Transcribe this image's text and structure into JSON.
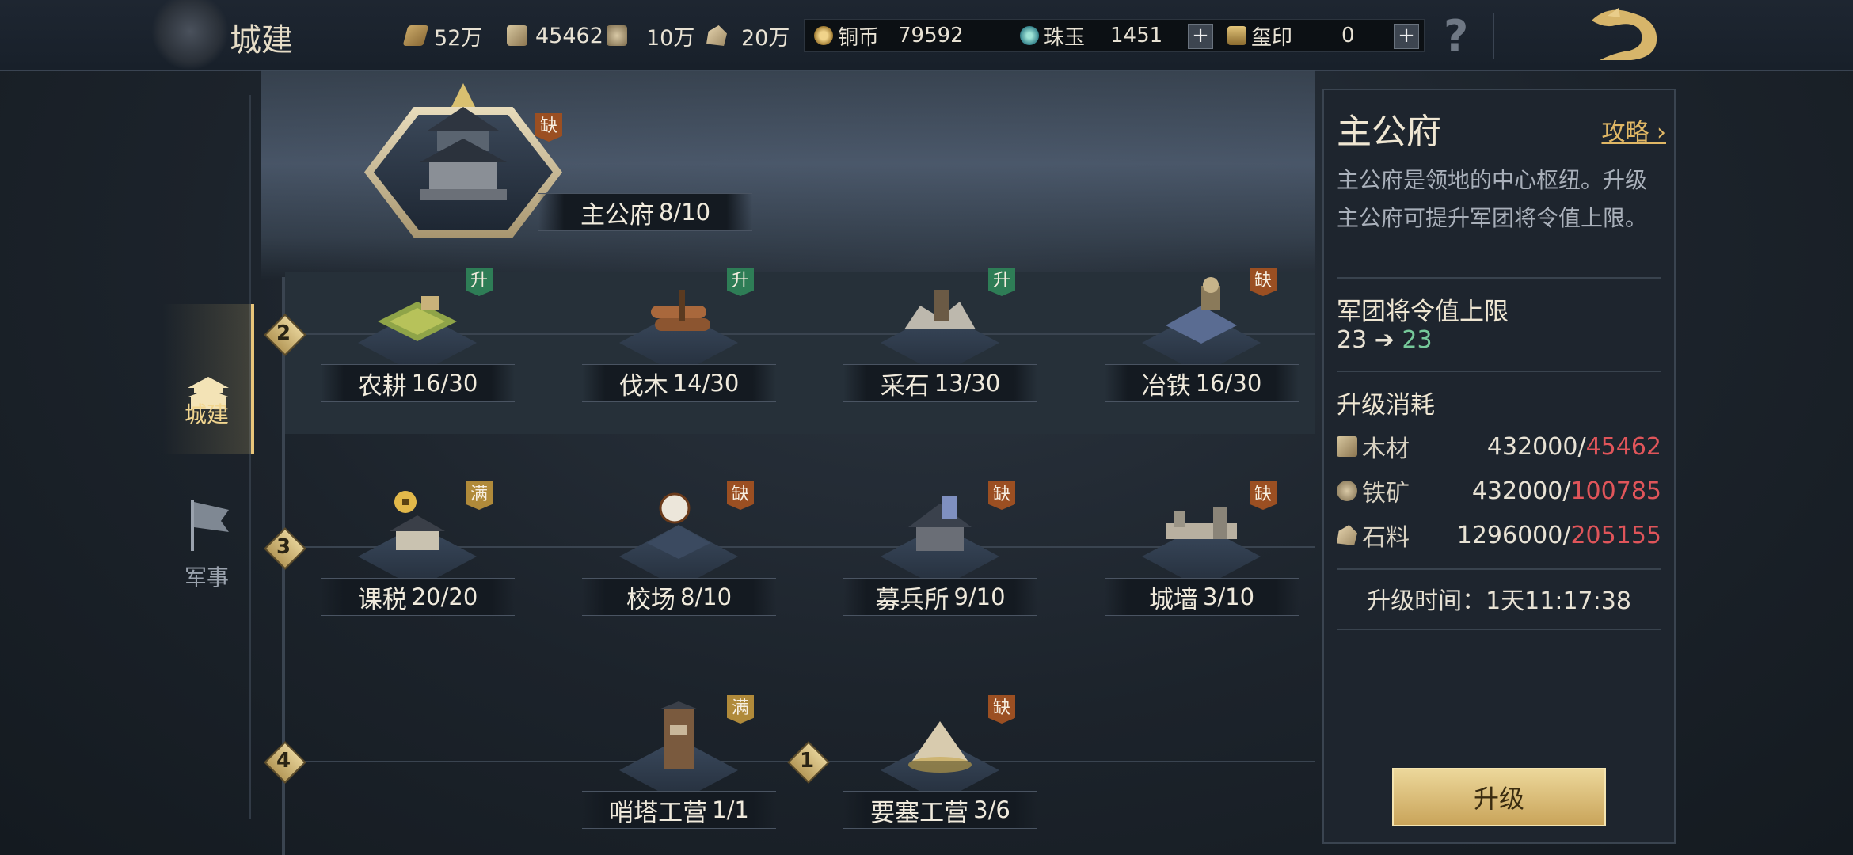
{
  "header": {
    "title": "城建",
    "resources": [
      {
        "icon": "grain-icon",
        "value": "52万"
      },
      {
        "icon": "wood-icon",
        "value": "45462"
      },
      {
        "icon": "iron-icon",
        "value": "10万"
      },
      {
        "icon": "stone-icon",
        "value": "20万"
      }
    ],
    "currencies": {
      "copper": {
        "label": "铜币",
        "value": "79592"
      },
      "jade": {
        "label": "珠玉",
        "value": "1451"
      },
      "seal": {
        "label": "玺印",
        "value": "0"
      }
    },
    "help_label": "?"
  },
  "sidebar": {
    "tabs": [
      {
        "label": "城建",
        "active": true
      },
      {
        "label": "军事",
        "active": false
      }
    ]
  },
  "main_hall": {
    "name": "主公府",
    "level": "8/10",
    "tag": "缺"
  },
  "rows": [
    {
      "num": "2",
      "buildings": [
        {
          "name": "农耕",
          "level": "16/30",
          "tag": "升"
        },
        {
          "name": "伐木",
          "level": "14/30",
          "tag": "升"
        },
        {
          "name": "采石",
          "level": "13/30",
          "tag": "升"
        },
        {
          "name": "冶铁",
          "level": "16/30",
          "tag": "缺"
        }
      ]
    },
    {
      "num": "3",
      "buildings": [
        {
          "name": "课税",
          "level": "20/20",
          "tag": "满"
        },
        {
          "name": "校场",
          "level": "8/10",
          "tag": "缺"
        },
        {
          "name": "募兵所",
          "level": "9/10",
          "tag": "缺"
        },
        {
          "name": "城墙",
          "level": "3/10",
          "tag": "缺"
        }
      ]
    },
    {
      "num": "4",
      "sub_num": "1",
      "buildings": [
        {
          "name": "哨塔工营",
          "level": "1/1",
          "tag": "满"
        },
        {
          "name": "要塞工营",
          "level": "3/6",
          "tag": "缺"
        }
      ]
    }
  ],
  "panel": {
    "title": "主公府",
    "guide": "攻略",
    "description": "主公府是领地的中心枢纽。升级主公府可提升军团将令值上限。",
    "cap_title": "军团将令值上限",
    "cap_from": "23",
    "cap_arrow": "➔",
    "cap_to": "23",
    "cost_title": "升级消耗",
    "costs": [
      {
        "name": "木材",
        "need": "432000/",
        "have": "45462"
      },
      {
        "name": "铁矿",
        "need": "432000/",
        "have": "100785"
      },
      {
        "name": "石料",
        "need": "1296000/",
        "have": "205155"
      }
    ],
    "time_label": "升级时间：",
    "time_value": "1天11:17:38",
    "upgrade_button": "升级"
  },
  "colors": {
    "accent_gold": "#e0b765",
    "shortage_red": "#e0555a",
    "increase_green": "#76c99a"
  }
}
